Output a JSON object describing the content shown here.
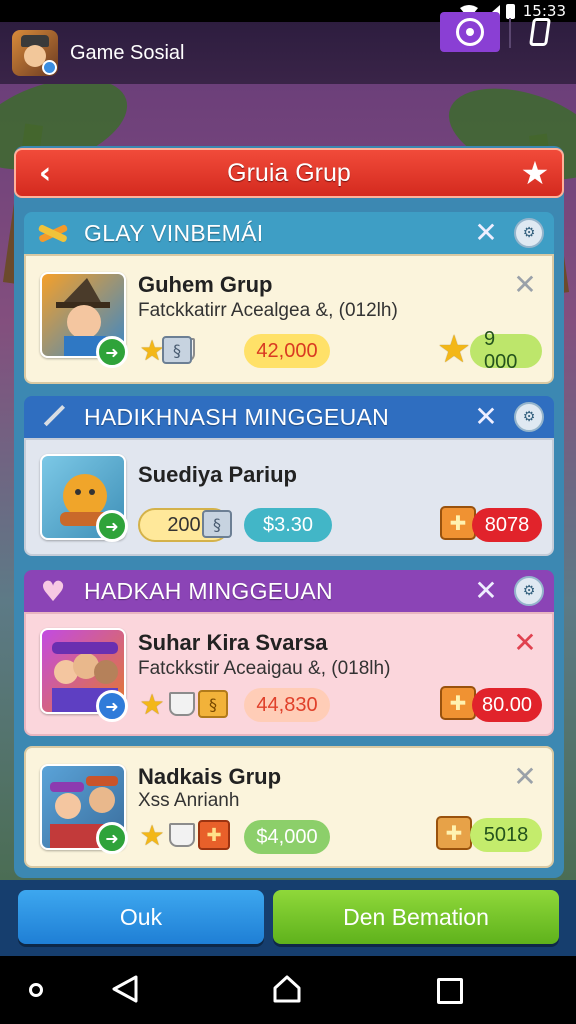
{
  "status_bar": {
    "time": "15:33"
  },
  "app_header": {
    "title": "Game Sosial"
  },
  "dialog": {
    "title": "Gruia Grup"
  },
  "sections": [
    {
      "title": "GLAY VINBEMÁI",
      "color": "#3e9ec5",
      "icon": "wrench-icon",
      "card": {
        "name": "Guhem Grup",
        "sub": "Fatckkatirr Acealgea &, (012lh)",
        "price": "42,000",
        "reward": "9 000"
      }
    },
    {
      "title": "HADIKHNASH MINGGEUAN",
      "color": "#2f6ec0",
      "icon": "pencil-icon",
      "card": {
        "name": "Suediya Pariup",
        "pill_left": "200",
        "price": "$3.30",
        "reward": "8078"
      }
    },
    {
      "title": "HADKAH MINGGEUAN",
      "color": "#8b44b6",
      "icon": "heart-icon",
      "card": {
        "name": "Suhar Kira Svarsa",
        "sub": "Fatckkstir Aceaigau &, (018lh)",
        "price": "44,830",
        "reward": "80.00"
      }
    }
  ],
  "extra_card": {
    "name": "Nadkais Grup",
    "sub": "Xss Anrianh",
    "price": "$4,000",
    "reward": "5018"
  },
  "buttons": {
    "ok": "Ouk",
    "confirm": "Den Bemation"
  }
}
